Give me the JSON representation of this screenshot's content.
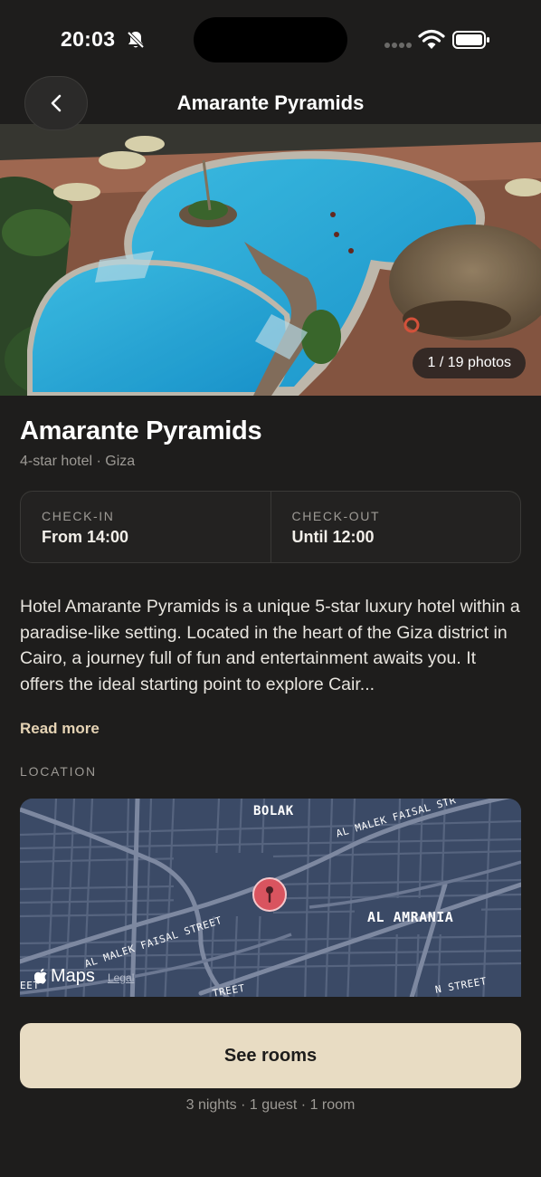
{
  "status_bar": {
    "time": "20:03",
    "icons": [
      "bell-slash-icon",
      "signal-icon",
      "wifi-icon",
      "battery-icon"
    ]
  },
  "header": {
    "back_icon": "chevron-left-icon",
    "title": "Amarante Pyramids"
  },
  "hero": {
    "photo_count": "1 / 19 photos"
  },
  "hotel": {
    "name": "Amarante Pyramids",
    "subtitle": "4-star hotel · Giza",
    "check_in_label": "CHECK-IN",
    "check_in_value": "From 14:00",
    "check_out_label": "CHECK-OUT",
    "check_out_value": "Until 12:00",
    "description": "Hotel Amarante Pyramids is a unique 5-star luxury hotel within a paradise-like setting. Located in the heart of the Giza district in Cairo, a journey full of fun and entertainment awaits you. It offers the ideal starting point to explore Cair...",
    "read_more": "Read more"
  },
  "location": {
    "section_label": "LOCATION",
    "map_labels": {
      "bolak": "BOLAK",
      "al_amrania": "AL AMRANIA",
      "faisal_top": "AL MALEK FAISAL STR",
      "faisal_left": "AL MALEK FAISAL STREET",
      "street_bottom_left": "EET",
      "street_bottom_mid": "TREET",
      "street_bottom_right": "N STREET"
    },
    "map_brand": "Maps",
    "map_legal": "Legal"
  },
  "footer": {
    "button_label": "See rooms",
    "summary": "3 nights · 1 guest · 1 room"
  },
  "colors": {
    "background": "#1e1d1c",
    "accent": "#e8dcc3",
    "map_background": "#3b4a66",
    "pin": "#d9545f"
  }
}
